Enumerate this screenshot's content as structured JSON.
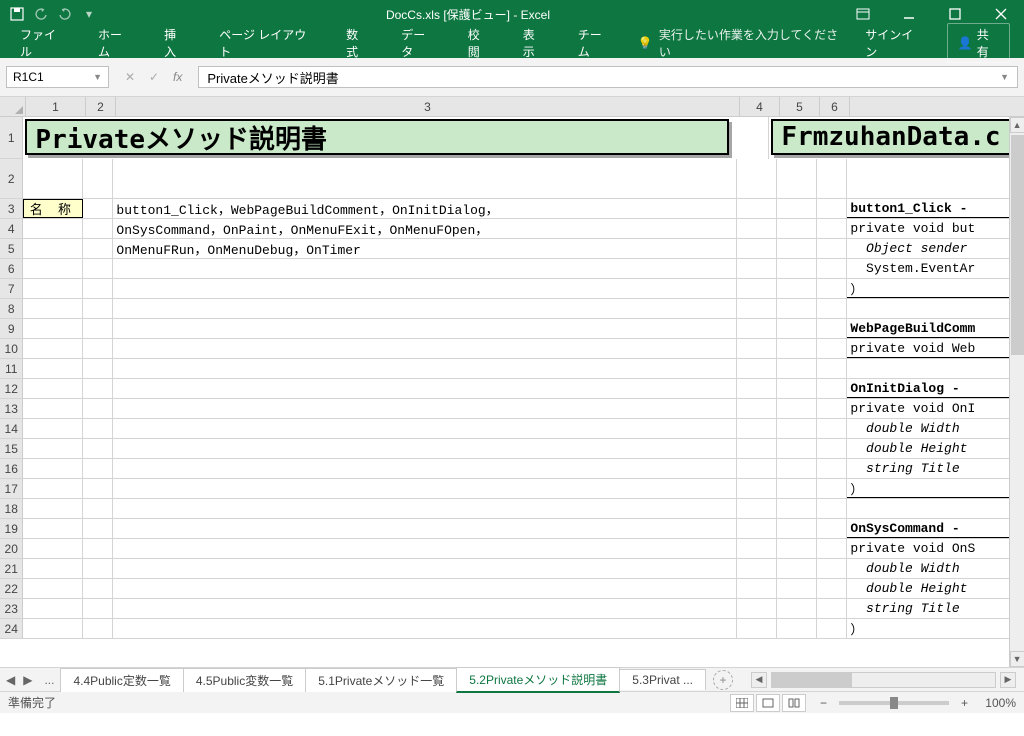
{
  "titlebar": {
    "filename": "DocCs.xls",
    "mode": "[保護ビュー]",
    "app": "- Excel"
  },
  "ribbon": {
    "tabs": [
      "ファイル",
      "ホーム",
      "挿入",
      "ページ レイアウト",
      "数式",
      "データ",
      "校閲",
      "表示",
      "チーム"
    ],
    "tellme": "実行したい作業を入力してください",
    "signin": "サインイン",
    "share": "共有"
  },
  "formula": {
    "namebox": "R1C1",
    "value": "Privateメソッド説明書"
  },
  "columns": {
    "c1": "1",
    "c2": "2",
    "c3": "3",
    "c4": "4",
    "c5": "5",
    "c6": "6"
  },
  "rows": [
    "1",
    "2",
    "3",
    "4",
    "5",
    "6",
    "7",
    "8",
    "9",
    "10",
    "11",
    "12",
    "13",
    "14",
    "15",
    "16",
    "17",
    "18",
    "19",
    "20",
    "21",
    "22",
    "23",
    "24"
  ],
  "sheet": {
    "title": "Privateメソッド説明書",
    "sideTitle": "FrmzuhanData.c",
    "label": "名 称",
    "line3": "button1_Click，WebPageBuildComment，OnInitDialog，",
    "line4": "OnSysCommand，OnPaint，OnMenuFExit，OnMenuFOpen，",
    "line5": "OnMenuFRun，OnMenuDebug，OnTimer",
    "r_btn1": "button1_Click -",
    "r_priv_but": "private void but",
    "r_obj_sender": "  Object sender",
    "r_sys_event": "  System.EventAr",
    "r_paren": "）",
    "r_webpage": "WebPageBuildComm",
    "r_priv_web": "private void Web",
    "r_oninit": "OnInitDialog - ",
    "r_priv_oninit": "private void OnI",
    "r_dbl_w": "  double Width",
    "r_dbl_h": "  double Height",
    "r_str_t": "  string Title",
    "r_onsys": "OnSysCommand - ",
    "r_priv_onsys": "private void OnS"
  },
  "tabs": {
    "t1": "4.4Public定数一覧",
    "t2": "4.5Public変数一覧",
    "t3": "5.1Privateメソッド一覧",
    "t4": "5.2Privateメソッド説明書",
    "t5": "5.3Privat ..."
  },
  "status": {
    "ready": "準備完了",
    "zoom": "100%"
  }
}
